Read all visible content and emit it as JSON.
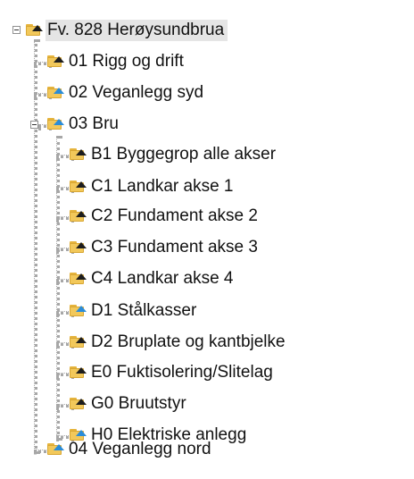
{
  "tree": {
    "root": {
      "label": "Fv. 828 Herøysundbrua",
      "icon": "folder-up-icon",
      "expanded": true,
      "selected": true
    },
    "items": [
      {
        "label": "01 Rigg og drift",
        "arrow": "dark",
        "icon": "folder-up-icon"
      },
      {
        "label": "02 Veganlegg syd",
        "arrow": "blue",
        "icon": "folder-up-icon"
      },
      {
        "label": "03 Bru",
        "arrow": "blue",
        "icon": "folder-up-icon",
        "expanded": true,
        "children": [
          {
            "label": "B1 Byggegrop alle akser",
            "arrow": "dark",
            "icon": "folder-up-icon"
          },
          {
            "label": "C1 Landkar akse 1",
            "arrow": "dark",
            "icon": "folder-up-icon"
          },
          {
            "label": "C2 Fundament akse 2",
            "arrow": "dark",
            "icon": "folder-up-icon"
          },
          {
            "label": "C3 Fundament akse 3",
            "arrow": "dark",
            "icon": "folder-up-icon"
          },
          {
            "label": "C4 Landkar akse 4",
            "arrow": "dark",
            "icon": "folder-up-icon"
          },
          {
            "label": "D1 Stålkasser",
            "arrow": "blue",
            "icon": "folder-up-icon"
          },
          {
            "label": "D2 Bruplate og kantbjelke",
            "arrow": "dark",
            "icon": "folder-up-icon"
          },
          {
            "label": "E0 Fuktisolering/Slitelag",
            "arrow": "dark",
            "icon": "folder-up-icon"
          },
          {
            "label": "G0 Bruutstyr",
            "arrow": "dark",
            "icon": "folder-up-icon"
          },
          {
            "label": "H0 Elektriske anlegg",
            "arrow": "blue",
            "icon": "folder-up-icon"
          }
        ]
      },
      {
        "label": "04 Veganlegg nord",
        "arrow": "blue",
        "icon": "folder-up-icon"
      }
    ]
  },
  "colors": {
    "arrow_dark": "#1d1d1d",
    "arrow_blue": "#2a8cd8",
    "folder": "#f2c85a",
    "selection": "#e5e5e5",
    "connector": "#a7a7a7"
  }
}
